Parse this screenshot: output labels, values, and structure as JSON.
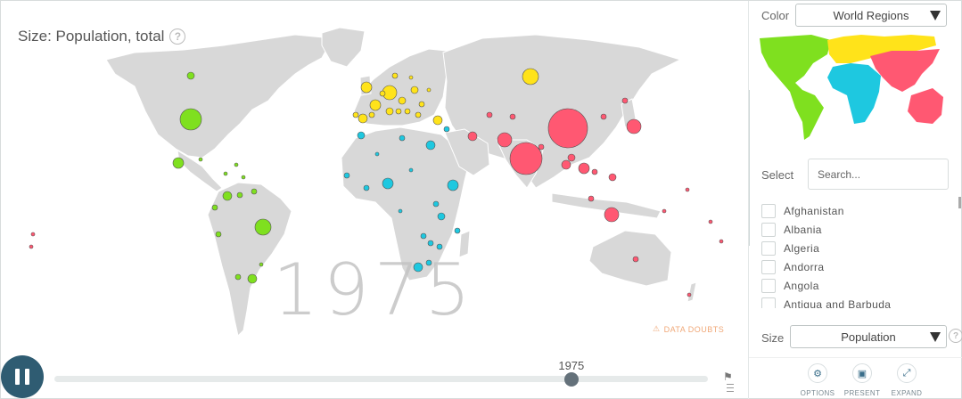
{
  "size_title": "Size: Population, total",
  "year": "1975",
  "data_doubts": "DATA DOUBTS",
  "timeslider": {
    "value_label": "1975",
    "progress": 0.791
  },
  "color": {
    "label": "Color",
    "selected": "World Regions"
  },
  "select": {
    "label": "Select",
    "placeholder": "Search..."
  },
  "countries": [
    "Afghanistan",
    "Albania",
    "Algeria",
    "Andorra",
    "Angola",
    "Antigua and Barbuda"
  ],
  "size": {
    "label": "Size",
    "selected": "Population"
  },
  "toolbar": {
    "options": "OPTIONS",
    "present": "PRESENT",
    "expand": "EXPAND"
  },
  "colors": {
    "americas": "#7fe01f",
    "europe": "#ffe31a",
    "africa": "#1ec8e0",
    "asia": "#ff5872",
    "land": "#d8d8d8",
    "slider": "#2f5c72"
  },
  "icons": [
    "help-icon",
    "pause-icon",
    "gear-icon",
    "present-icon",
    "expand-icon",
    "warning-icon",
    "flag-icon",
    "caret-down-icon"
  ]
}
